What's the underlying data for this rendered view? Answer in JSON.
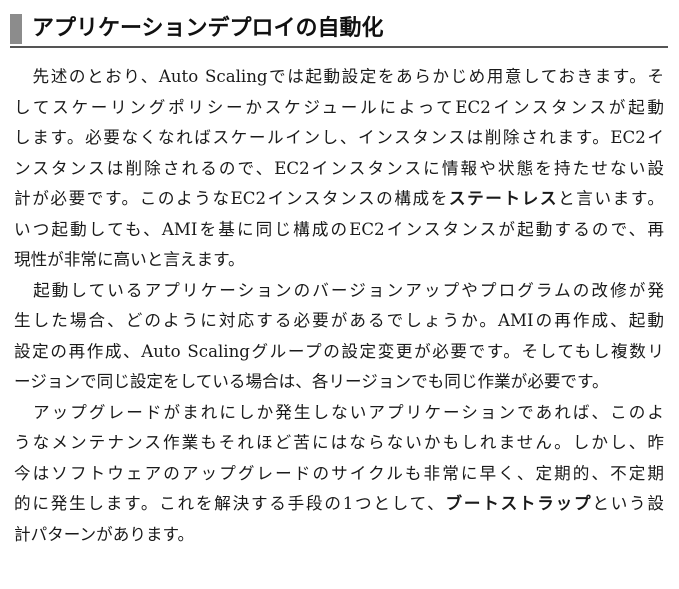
{
  "heading": {
    "title": "アプリケーションデプロイの自動化"
  },
  "paragraphs": [
    {
      "lines": [
        {
          "pre": "先述のとおり、Auto Scalingでは起動設定をあらかじめ用意しておきます。そ"
        },
        {
          "pre": "してスケーリングポリシーかスケジュールによってEC2インスタンスが起動"
        },
        {
          "pre": "します。必要なくなればスケールインし、インスタンスは削除されます。EC2イ"
        },
        {
          "pre": "ンスタンスは削除されるので、EC2インスタンスに情報や状態を持たせない設"
        },
        {
          "pre": "計が必要です。このようなEC2インスタンスの構成を",
          "bold": "ステートレス",
          "post": "と言います。"
        },
        {
          "pre": "いつ起動しても、AMIを基に同じ構成のEC2インスタンスが起動するので、再"
        },
        {
          "pre": "現性が非常に高いと言えます。"
        }
      ]
    },
    {
      "lines": [
        {
          "pre": "起動しているアプリケーションのバージョンアップやプログラムの改修が発"
        },
        {
          "pre": "生した場合、どのように対応する必要があるでしょうか。AMIの再作成、起動"
        },
        {
          "pre": "設定の再作成、Auto Scalingグループの設定変更が必要です。そしてもし複数リ"
        },
        {
          "pre": "ージョンで同じ設定をしている場合は、各リージョンでも同じ作業が必要です。"
        }
      ]
    },
    {
      "lines": [
        {
          "pre": "アップグレードがまれにしか発生しないアプリケーションであれば、このよ"
        },
        {
          "pre": "うなメンテナンス作業もそれほど苦にはならないかもしれません。しかし、昨"
        },
        {
          "pre": "今はソフトウェアのアップグレードのサイクルも非常に早く、定期的、不定期"
        },
        {
          "pre": "的に発生します。これを解決する手段の1つとして、",
          "bold": "ブートストラップ",
          "post": "という設"
        },
        {
          "pre": "計パターンがあります。"
        }
      ]
    }
  ]
}
